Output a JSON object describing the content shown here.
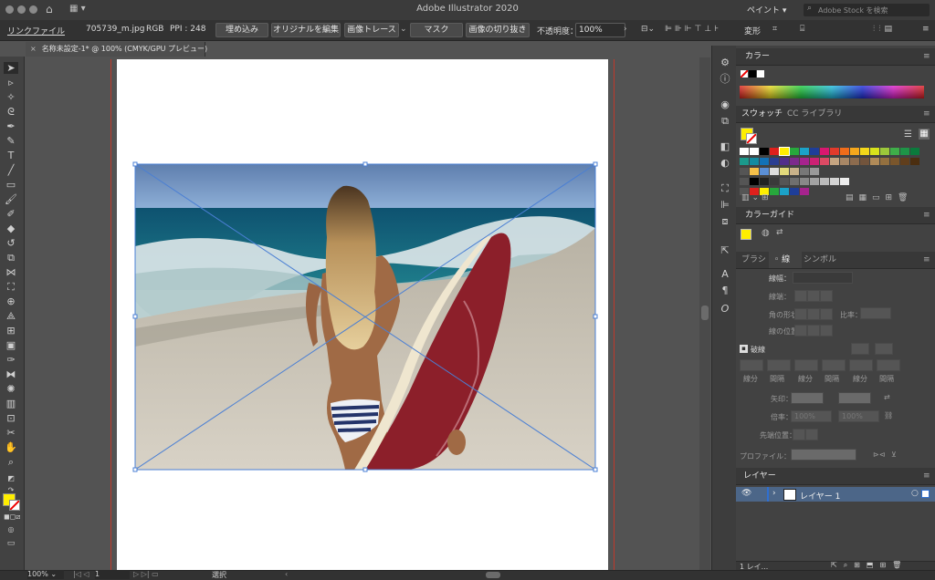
{
  "app": {
    "title": "Adobe Illustrator 2020",
    "workspace": "ペイント",
    "stock_search_placeholder": "Adobe Stock を検索"
  },
  "control_bar": {
    "link_file": "リンクファイル",
    "filename": "705739_m.jpg",
    "color_mode": "RGB",
    "ppi": "PPI : 248",
    "embed": "埋め込み",
    "edit_original": "オリジナルを編集",
    "image_trace": "画像トレース",
    "mask": "マスク",
    "crop_image": "画像の切り抜き",
    "opacity_label": "不透明度：",
    "opacity_value": "100%",
    "transform": "変形"
  },
  "document_tab": {
    "title": "名称未設定-1* @ 100% (CMYK/GPU プレビュー)"
  },
  "panels": {
    "color": {
      "title": "カラー"
    },
    "swatches": {
      "tab_swatches": "スウォッチ",
      "tab_cc": "CC ライブラリ"
    },
    "color_guide": {
      "title": "カラーガイド"
    },
    "stroke": {
      "tab_brush": "ブラシ",
      "tab_stroke": "線",
      "tab_symbol": "シンボル",
      "weight_label": "線幅：",
      "cap_label": "線端：",
      "corner_label": "角の形状：",
      "limit_label": "比率：",
      "align_label": "線の位置：",
      "dashed_label": "破線",
      "dash_fields": [
        "線分",
        "間隔",
        "線分",
        "間隔",
        "線分",
        "間隔"
      ],
      "arrow_label": "矢印：",
      "scale_label": "倍率：",
      "scale_value_1": "100%",
      "scale_value_2": "100%",
      "tip_label": "先端位置：",
      "profile_label": "プロファイル："
    },
    "layers": {
      "title": "レイヤー",
      "layer_name": "レイヤー 1",
      "count": "1 レイ..."
    }
  },
  "status_bar": {
    "zoom": "100%",
    "artboard": "1",
    "tool": "選択"
  },
  "colors": {
    "fill": "#ffee00",
    "accent": "#4a7fd4"
  }
}
